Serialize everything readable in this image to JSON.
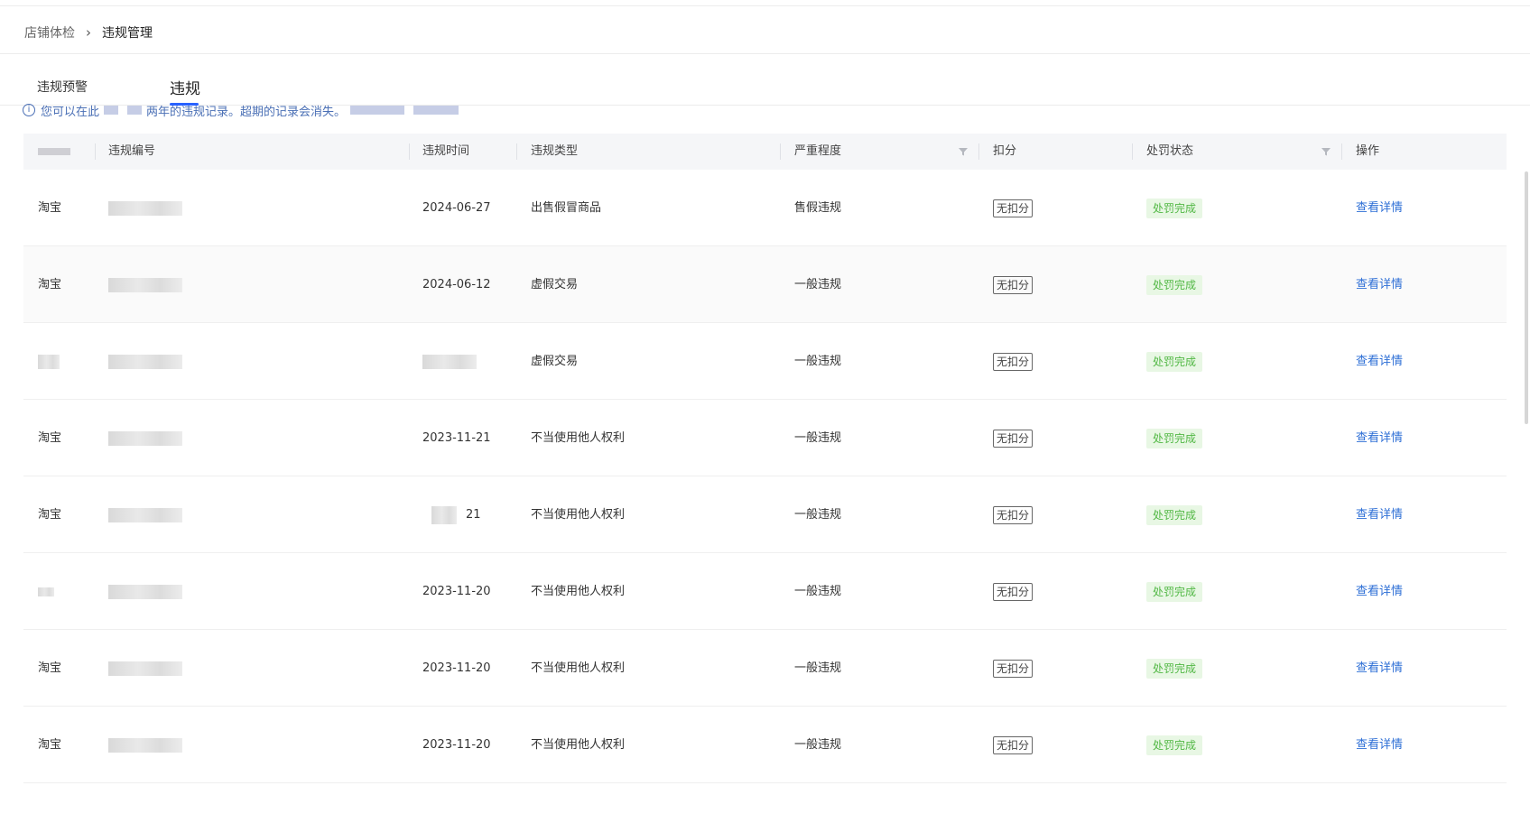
{
  "breadcrumb": {
    "root": "店铺体检",
    "separator": "›",
    "current": "违规管理"
  },
  "tabs": [
    {
      "label": "违规预警"
    },
    {
      "label": "违规"
    }
  ],
  "notice": {
    "text_start": "您可以在此",
    "text_mid": "两年的违规记录。超期的记录会消失。"
  },
  "table": {
    "headers": {
      "platform": "",
      "id": "违规编号",
      "date": "违规时间",
      "type": "违规类型",
      "severity": "严重程度",
      "deduct": "扣分",
      "status": "处罚状态",
      "op": "操作"
    },
    "rows": [
      {
        "platform": "淘宝",
        "date": "2024-06-27",
        "type": "出售假冒商品",
        "severity": "售假违规",
        "deduct": "无扣分",
        "status": "处罚完成",
        "op": "查看详情"
      },
      {
        "platform": "淘宝",
        "date": "2024-06-12",
        "type": "虚假交易",
        "severity": "一般违规",
        "deduct": "无扣分",
        "status": "处罚完成",
        "op": "查看详情"
      },
      {
        "platform": "",
        "date": "",
        "type": "虚假交易",
        "severity": "一般违规",
        "deduct": "无扣分",
        "status": "处罚完成",
        "op": "查看详情"
      },
      {
        "platform": "淘宝",
        "date": "2023-11-21",
        "type": "不当使用他人权利",
        "severity": "一般违规",
        "deduct": "无扣分",
        "status": "处罚完成",
        "op": "查看详情"
      },
      {
        "platform": "淘宝",
        "date": "21",
        "type": "不当使用他人权利",
        "severity": "一般违规",
        "deduct": "无扣分",
        "status": "处罚完成",
        "op": "查看详情"
      },
      {
        "platform": "",
        "date": "2023-11-20",
        "type": "不当使用他人权利",
        "severity": "一般违规",
        "deduct": "无扣分",
        "status": "处罚完成",
        "op": "查看详情"
      },
      {
        "platform": "淘宝",
        "date": "2023-11-20",
        "type": "不当使用他人权利",
        "severity": "一般违规",
        "deduct": "无扣分",
        "status": "处罚完成",
        "op": "查看详情"
      },
      {
        "platform": "淘宝",
        "date": "2023-11-20",
        "type": "不当使用他人权利",
        "severity": "一般违规",
        "deduct": "无扣分",
        "status": "处罚完成",
        "op": "查看详情"
      }
    ]
  },
  "colors": {
    "accent": "#2962ff",
    "link": "#2e6fd6",
    "status_bg": "#e8f7e4",
    "status_fg": "#52b845"
  }
}
